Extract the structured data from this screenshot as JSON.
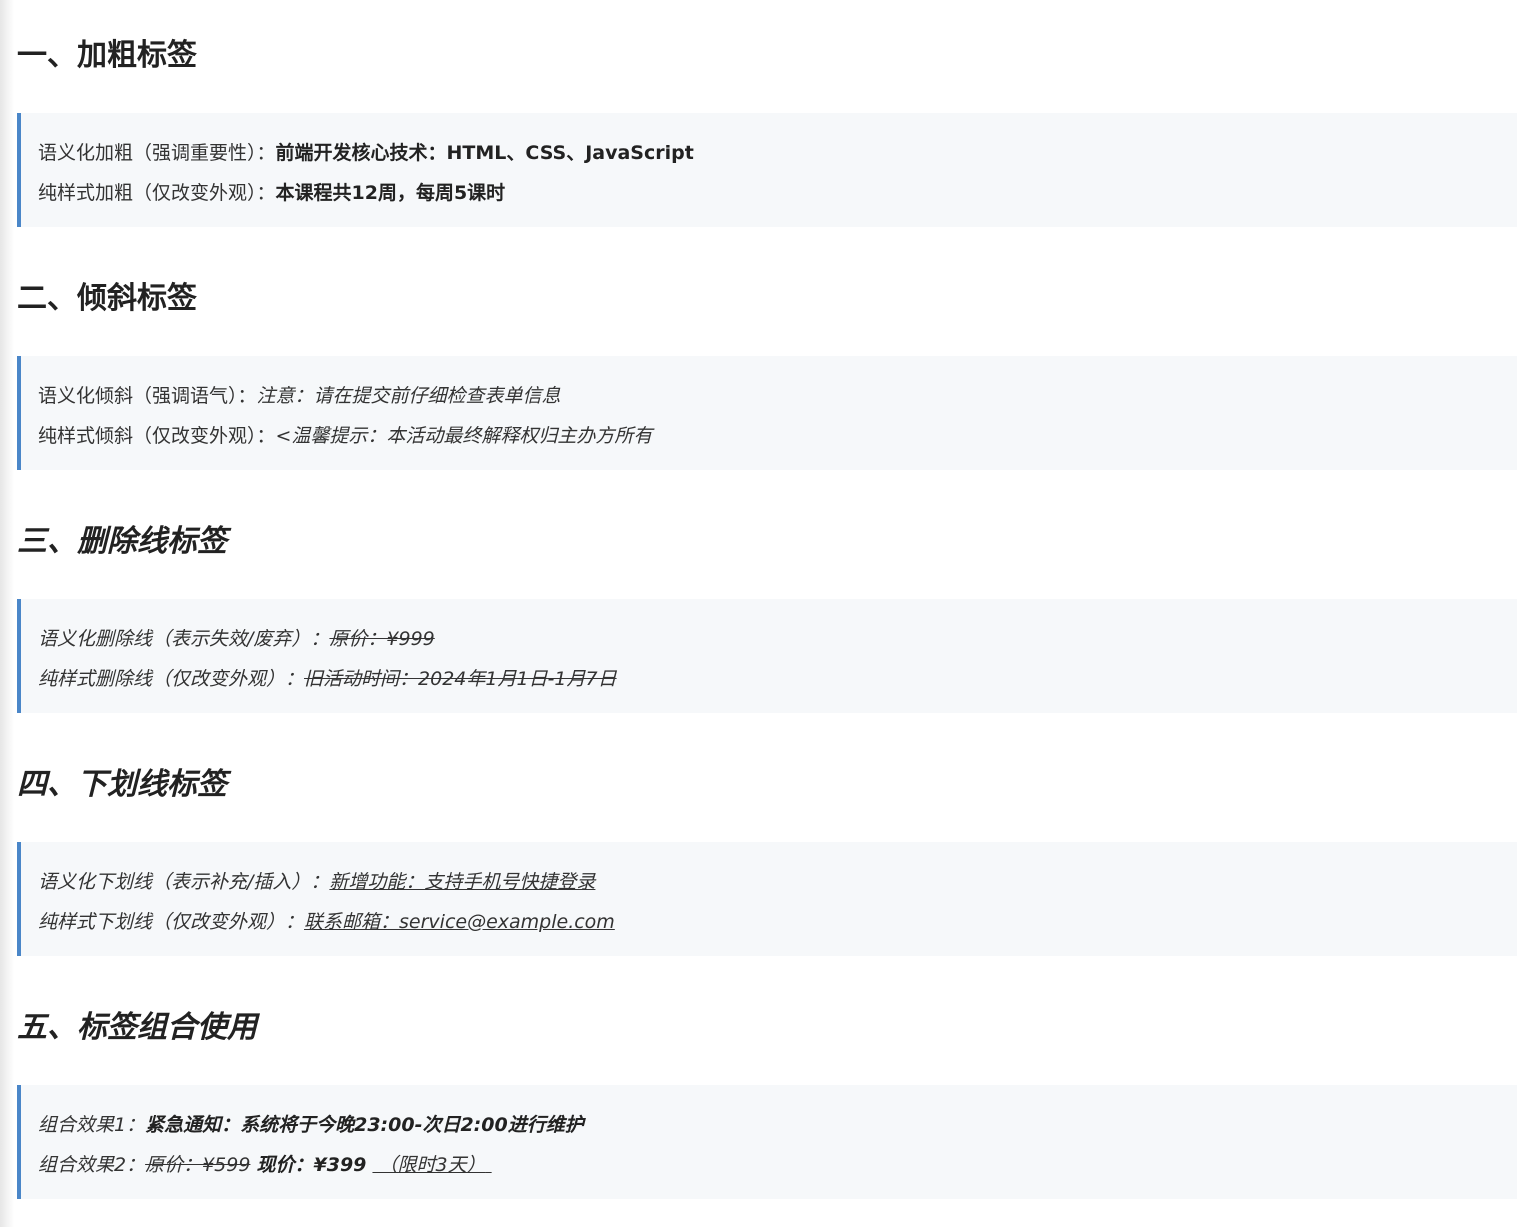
{
  "sections": [
    {
      "heading": "一、加粗标签",
      "line1": {
        "label": "语义化加粗（强调重要性）：",
        "value": "前端开发核心技术：HTML、CSS、JavaScript"
      },
      "line2": {
        "label": "纯样式加粗（仅改变外观）：",
        "value": "本课程共12周，每周5课时"
      }
    },
    {
      "heading": "二、倾斜标签",
      "line1": {
        "label": "语义化倾斜（强调语气）：",
        "value": "注意：请在提交前仔细检查表单信息"
      },
      "line2": {
        "label": "纯样式倾斜（仅改变外观）：",
        "value": "<温馨提示：本活动最终解释权归主办方所有"
      }
    },
    {
      "heading": "三、删除线标签",
      "line1": {
        "label": "语义化删除线（表示失效/废弃）：",
        "value": "原价：¥999"
      },
      "line2": {
        "label": "纯样式删除线（仅改变外观）：",
        "value": "旧活动时间：2024年1月1日-1月7日"
      }
    },
    {
      "heading": "四、下划线标签",
      "line1": {
        "label": "语义化下划线（表示补充/插入）：",
        "value": "新增功能：支持手机号快捷登录"
      },
      "line2": {
        "label": "纯样式下划线（仅改变外观）：",
        "value": "联系邮箱：service@example.com"
      }
    },
    {
      "heading": "五、标签组合使用",
      "line1": {
        "label": "组合效果1：",
        "value": "紧急通知：系统将于今晚23:00-次日2:00进行维护"
      },
      "line2": {
        "label": "组合效果2：",
        "old_price": "原价：¥599",
        "new_price_label": "现价：",
        "new_price": "¥399",
        "note": "（限时3天）"
      }
    }
  ]
}
